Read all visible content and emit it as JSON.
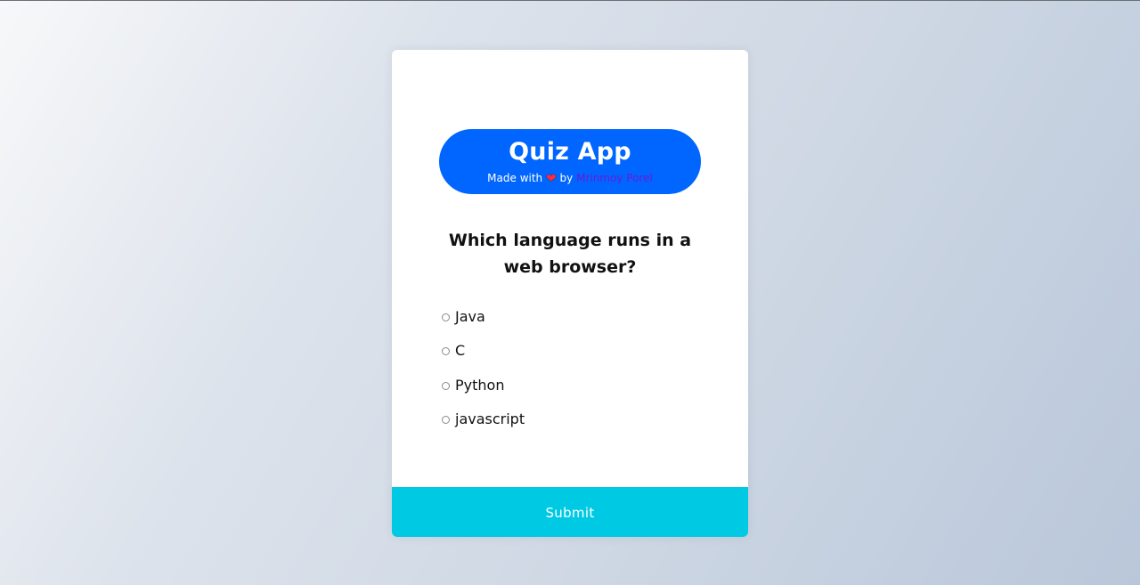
{
  "header": {
    "title": "Quiz App",
    "credit_prefix": "Made with",
    "heart_icon": "❤",
    "credit_by": "by",
    "author": "Mrinmoy Porel"
  },
  "quiz": {
    "question": "Which language runs in a web browser?",
    "options": [
      {
        "label": "Java",
        "selected": false
      },
      {
        "label": "C",
        "selected": false
      },
      {
        "label": "Python",
        "selected": false
      },
      {
        "label": "javascript",
        "selected": false
      }
    ],
    "submit_label": "Submit"
  },
  "colors": {
    "header_bg": "#0066ff",
    "submit_bg": "#00c9e4",
    "author_link": "#6a1bd6",
    "heart": "#ff2a3a"
  }
}
